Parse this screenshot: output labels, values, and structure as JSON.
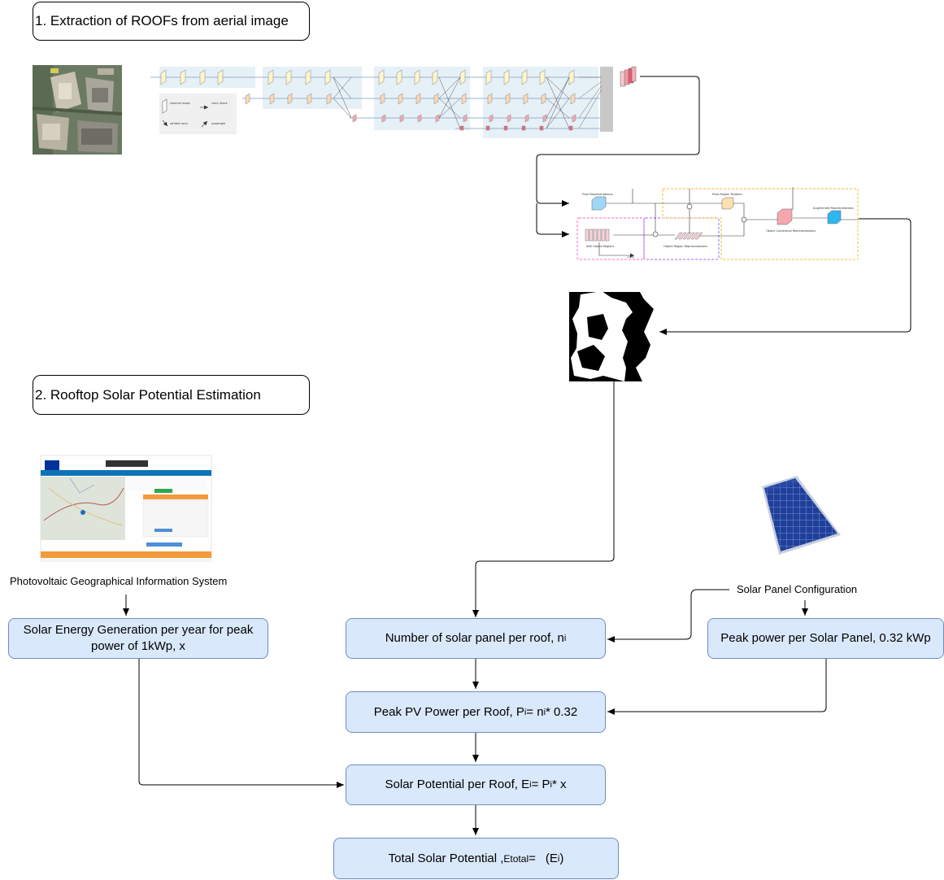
{
  "sections": {
    "extraction_title": "1. Extraction of ROOFs from aerial image",
    "estimation_title": "2. Rooftop Solar Potential Estimation"
  },
  "hrnet_legend": {
    "channel_maps": "channel maps",
    "conv_block": "conv. block",
    "strided_conv": "strided conv.",
    "upsample": "upsample"
  },
  "ocr": {
    "pixel_representations": "Pixel Representations",
    "pixel_region_relation": "Pixel-Region Relation",
    "augmented_representations": "Augmented Representations",
    "soft_object_regions": "Soft Object Regions",
    "object_region_representations": "Object Region Representations",
    "object_contextual_representations": "Object Contextual Representations",
    "loss": "Loss"
  },
  "labels": {
    "pvgis": "Photovoltaic Geographical Information System",
    "solar_panel_configuration": "Solar Panel Configuration"
  },
  "boxes": {
    "solar_energy_gen": "Solar Energy Generation per year for peak power of 1kWp, x",
    "num_panels": {
      "text": "Number of solar panel per roof, n",
      "sub": "i"
    },
    "peak_power_panel": "Peak power per Solar Panel, 0.32 kWp",
    "peak_pv_power": {
      "text": "Peak PV Power per Roof, P",
      "sub1": "i",
      "mid": " = n",
      "sub2": "i",
      "tail": " * 0.32"
    },
    "solar_potential": {
      "text": "Solar Potential per Roof, E",
      "sub1": "i",
      "mid": " = P",
      "sub2": "i",
      "tail": " * x"
    },
    "total": {
      "text": "Total Solar Potential , ",
      "etotal": "Etotal",
      "eq": " = ",
      "tail_open": " (E",
      "sub": "i",
      "tail_close": ")"
    }
  },
  "colors": {
    "box_fill": "#dae8fc",
    "box_stroke": "#6c8ebf",
    "ocr_pink": "#ff66cc",
    "ocr_purple": "#9966ff",
    "ocr_orange": "#ffbb33",
    "panel_blue": "#1e3a8a"
  }
}
